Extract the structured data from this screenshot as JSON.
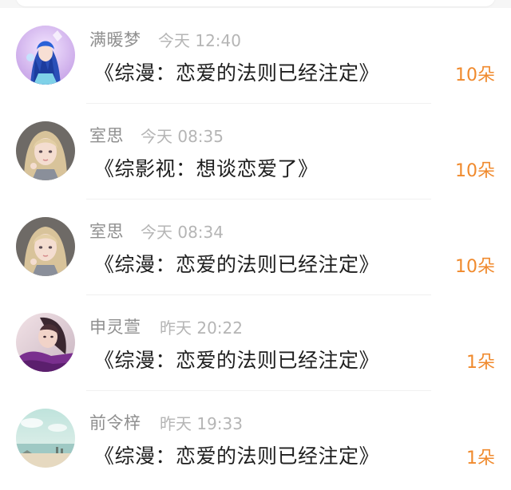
{
  "gifts": [
    {
      "name": "满暖梦",
      "time": "今天 12:40",
      "book": "《综漫：恋爱的法则已经注定》",
      "count": "10朵",
      "avatar_icon": "anime-girl-blue-hair-icon"
    },
    {
      "name": "室思",
      "time": "今天 08:35",
      "book": "《综影视：想谈恋爱了》",
      "count": "10朵",
      "avatar_icon": "anime-girl-blonde-icon"
    },
    {
      "name": "室思",
      "time": "今天 08:34",
      "book": "《综漫：恋爱的法则已经注定》",
      "count": "10朵",
      "avatar_icon": "anime-girl-blonde-icon"
    },
    {
      "name": "申灵萱",
      "time": "昨天 20:22",
      "book": "《综漫：恋爱的法则已经注定》",
      "count": "1朵",
      "avatar_icon": "girl-portrait-purple-icon"
    },
    {
      "name": "前令梓",
      "time": "昨天 19:33",
      "book": "《综漫：恋爱的法则已经注定》",
      "count": "1朵",
      "avatar_icon": "seaside-landscape-icon"
    }
  ],
  "colors": {
    "name": "#8f8f8f",
    "time": "#b5b5b5",
    "book": "#1e1e1e",
    "count": "#f08a2d"
  }
}
